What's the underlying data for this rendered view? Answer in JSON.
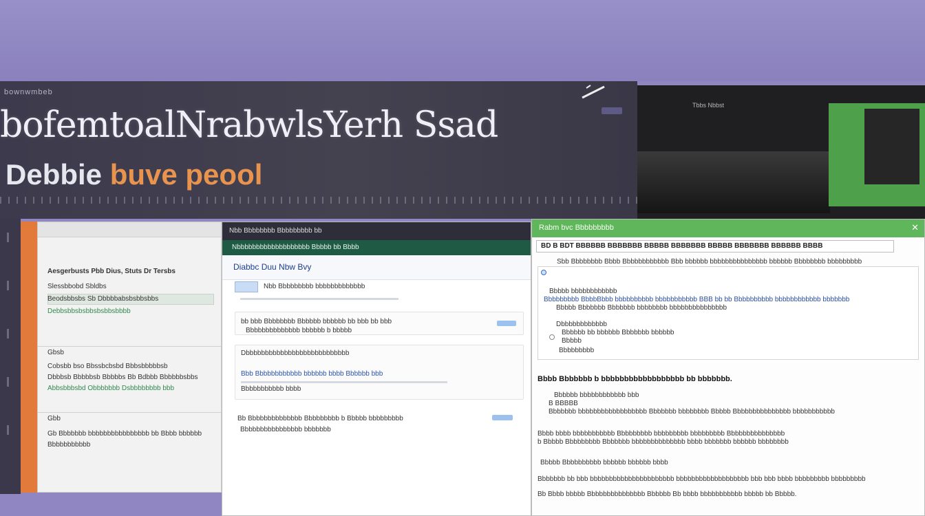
{
  "hero": {
    "kicker": "bownwmbeb",
    "title": "bofemtoalNrabwlsYerh Ssad",
    "subtitle_white": "Debbie",
    "subtitle_orange": "buve peool"
  },
  "video": {
    "title": "Tbbs Nbbst"
  },
  "left_panel": {
    "header": "Aesgerbusts Pbb   Dius,   Stuts   Dr Tersbs",
    "rows": [
      "Slessbbobd Sbldbs",
      "Beodsbbsbs Sb Dbbbbabsbsbbsbbs",
      "Debbsbbsbsbbsbsbbsbbbb",
      "Gbsb",
      "Cobsbb bso Bbssbcbsbd Bbbsbbbbbsb",
      "Dbbbsb Bbbbbsb Bbbbbs Bb Bdbbb Bbbbbbsbbs",
      "Abbsbbbsbd Obbbbbbb Dsbbbbbbbb bbb",
      "Gbb",
      "Gb  Bbbbbbb bbbbbbbbbbbbbbbb bb Bbbb bbbbbb",
      "Bbbbbbbbbbb"
    ]
  },
  "mid_panel": {
    "topbar": "Nbb  Bbbbbbbb  Bbbbbbbbb  bb",
    "greenbar": "Nbbbbbbbbbbbbbbbbbbb Bbbbb  bb Bbbb",
    "heading": "Diabbc Duu Nbw Bvy",
    "row1": "Nbb Bbbbbbbbb bbbbbbbbbbbbb",
    "row2": "bb bbb Bbbbbbbb Bbbbbb bbbbbb bb bbb bb bbb",
    "row3": "Bbbbbbbbbbbbbb bbbbbb b bbbbb",
    "row4": "Dbbbbbbbbbbbbbbbbbbbbbbbbbbb",
    "row5": "Bbb Bbbbbbbbbbbb bbbbbb bbbb  Bbbbbb bbb",
    "row6": "Bbbbbbbbbbb bbbb",
    "row7": "Bb Bbbbbbbbbbbbbb  Bbbbbbbbb  b Bbbbb bbbbbbbbb",
    "row8": "Bbbbbbbbbbbbbbbb bbbbbbb"
  },
  "right_panel": {
    "titlebar": "Rabm bvc Bbbbbbbbb",
    "address": "BD  B  BDT  BBBBBB  BBBBBBB BBBBB BBBBBBB  BBBBB  BBBBBBB BBBBBB  BBBB",
    "intro": "Sbb Bbbbbbbb Bbbb Bbbbbbbbbbbb Bbb bbbbbb bbbbbbbbbbbbbbb bbbbbb Bbbbbbbb bbbbbbbbb",
    "option1_title": "Bbbbb bbbbbbbbbbbb",
    "option1_desc": "Bbbbbbbbb BbbbBbbb bbbbbbbbbb bbbbbbbbbbb BBB bb bb Bbbbbbbbbb bbbbbbbbbbbb bbbbbbb",
    "option1_desc2": "Bbbbb Bbbbbbb Bbbbbbb bbbbbbbb bbbbbbbbbbbbbbb",
    "option2_title": "Dbbbbbbbbbbbb",
    "option2_desc": "Bbbbbb bb  bbbbbb Bbbbbbb bbbbbb",
    "option2_desc2": "Bbbbb",
    "option3_title": "Bbbbbbbbb",
    "section_title": "Bbbb Bbbbbbb b bbbbbbbbbbbbbbbbbb bb bbbbbbb.",
    "sub1": "Bbbbbb bbbbbbbbbbbb bbb",
    "sub2": "B BBBBB",
    "sub3": "Bbbbbbb bbbbbbbbbbbbbbbbbb Bbbbbbb bbbbbbbb Bbbbb Bbbbbbbbbbbbbbb bbbbbbbbbbb",
    "para1": "Bbbb bbbb bbbbbbbbbbb  Bbbbbbbbb bbbbbbbbb bbbbbbbbb Bbbbbbbbbbbbbbb",
    "para2": "b  Bbbbb Bbbbbbbbb Bbbbbbb bbbbbbbbbbbbbb bbbb bbbbbbb bbbbbb bbbbbbbb",
    "sub4": "Bbbbb Bbbbbbbbbb bbbbbb bbbbbb bbbb",
    "para3": "Bbbbbbb bb bbb bbbbbbbbbbbbbbbbbbbbbb bbbbbbbbbbbbbbbbbbb bbb bbb bbbb bbbbbbbbb bbbbbbbbb",
    "para4": "Bb Bbbb bbbbb Bbbbbbbbbbbbbbb Bbbbbb  Bb bbbb bbbbbbbbbbb bbbbb bb Bbbbb."
  },
  "colors": {
    "background": "#8f86c2",
    "hero_orange": "#e8944f",
    "accent_green": "#5fb65b",
    "mid_green": "#1f5a45",
    "side_orange": "#e27a3b"
  }
}
